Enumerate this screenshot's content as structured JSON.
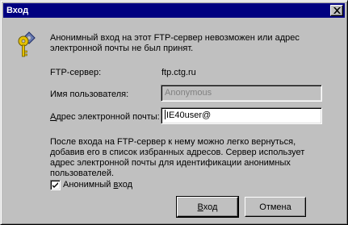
{
  "window": {
    "title": "Вход",
    "close_glyph": "close-icon"
  },
  "message": "Анонимный вход на этот FTP-сервер  невозможен или адрес электронной почты не был принят.",
  "fields": {
    "server_label": "FTP-сервер:",
    "server_value": "ftp.ctg.ru",
    "username_label": "Имя пользователя:",
    "username_value": "Anonymous",
    "email_label": "Адрес электронной почты:",
    "email_value": "IE40user@"
  },
  "info": "После входа на FTP-сервер к нему можно легко вернуться, добавив его в список избранных адресов. Сервер использует адрес электронной почты для идентификации анонимных пользователей.",
  "checkbox": {
    "label": "Анонимный вход",
    "checked": true
  },
  "buttons": {
    "login": "Вход",
    "cancel": "Отмена"
  },
  "colors": {
    "titlebar": "#000080",
    "face": "#c0c0c0"
  }
}
